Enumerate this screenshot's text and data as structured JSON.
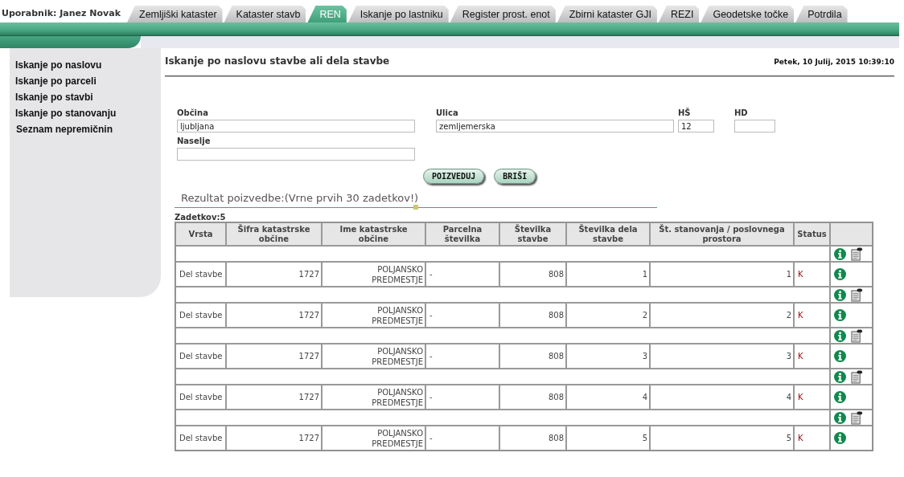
{
  "user": {
    "label": "Uporabnik:",
    "name": "Janez Novak"
  },
  "tabs": [
    {
      "label": "Zemljiški kataster",
      "selected": false
    },
    {
      "label": "Kataster stavb",
      "selected": false
    },
    {
      "label": "REN",
      "selected": true
    },
    {
      "label": "Iskanje po lastniku",
      "selected": false
    },
    {
      "label": "Register prost. enot",
      "selected": false
    },
    {
      "label": "Zbirni kataster GJI",
      "selected": false
    },
    {
      "label": "REZI",
      "selected": false
    },
    {
      "label": "Geodetske točke",
      "selected": false
    },
    {
      "label": "Potrdila",
      "selected": false
    }
  ],
  "sidebar": {
    "items": [
      "Iskanje po naslovu",
      "Iskanje po parceli",
      "Iskanje po stavbi",
      "Iskanje po stanovanju",
      "Seznam nepremičnin"
    ]
  },
  "page_title": "Iskanje po naslovu stavbe ali dela stavbe",
  "datetime": "Petek, 10 Julij, 2015 10:39:10",
  "form": {
    "obcina": {
      "label": "Občina",
      "value": "ljubljana"
    },
    "ulica": {
      "label": "Ulica",
      "value": "zemljemerska"
    },
    "hs": {
      "label": "HŠ",
      "value": "12"
    },
    "hd": {
      "label": "HD"
    },
    "naselje": {
      "label": "Naselje"
    }
  },
  "buttons": [
    "POIZVEDUJ",
    "BRIŠI"
  ],
  "result_title": "Rezultat poizvedbe:(Vrne prvih 30 zadetkov!)",
  "count": "Zadetkov:5",
  "table": {
    "columns": [
      "Vrsta",
      "Šifra katastrske občine",
      "Ime katastrske občine",
      "Parcelna številka",
      "Številka stavbe",
      "Številka dela stavbe",
      "Št. stanovanja / poslovnega prostora",
      "Status"
    ],
    "rows": [
      {
        "cells": [
          "Del stavbe",
          "1727",
          "POLJANSKO PREDMESTJE",
          "-",
          "808",
          "1",
          "1",
          "K"
        ]
      },
      {
        "cells": [
          "Del stavbe",
          "1727",
          "POLJANSKO PREDMESTJE",
          "-",
          "808",
          "2",
          "2",
          "K"
        ]
      },
      {
        "cells": [
          "Del stavbe",
          "1727",
          "POLJANSKO PREDMESTJE",
          "-",
          "808",
          "3",
          "3",
          "K"
        ]
      },
      {
        "cells": [
          "Del stavbe",
          "1727",
          "POLJANSKO PREDMESTJE",
          "-",
          "808",
          "4",
          "4",
          "K"
        ]
      },
      {
        "cells": [
          "Del stavbe",
          "1727",
          "POLJANSKO PREDMESTJE",
          "-",
          "808",
          "5",
          "5",
          "K"
        ]
      }
    ]
  }
}
